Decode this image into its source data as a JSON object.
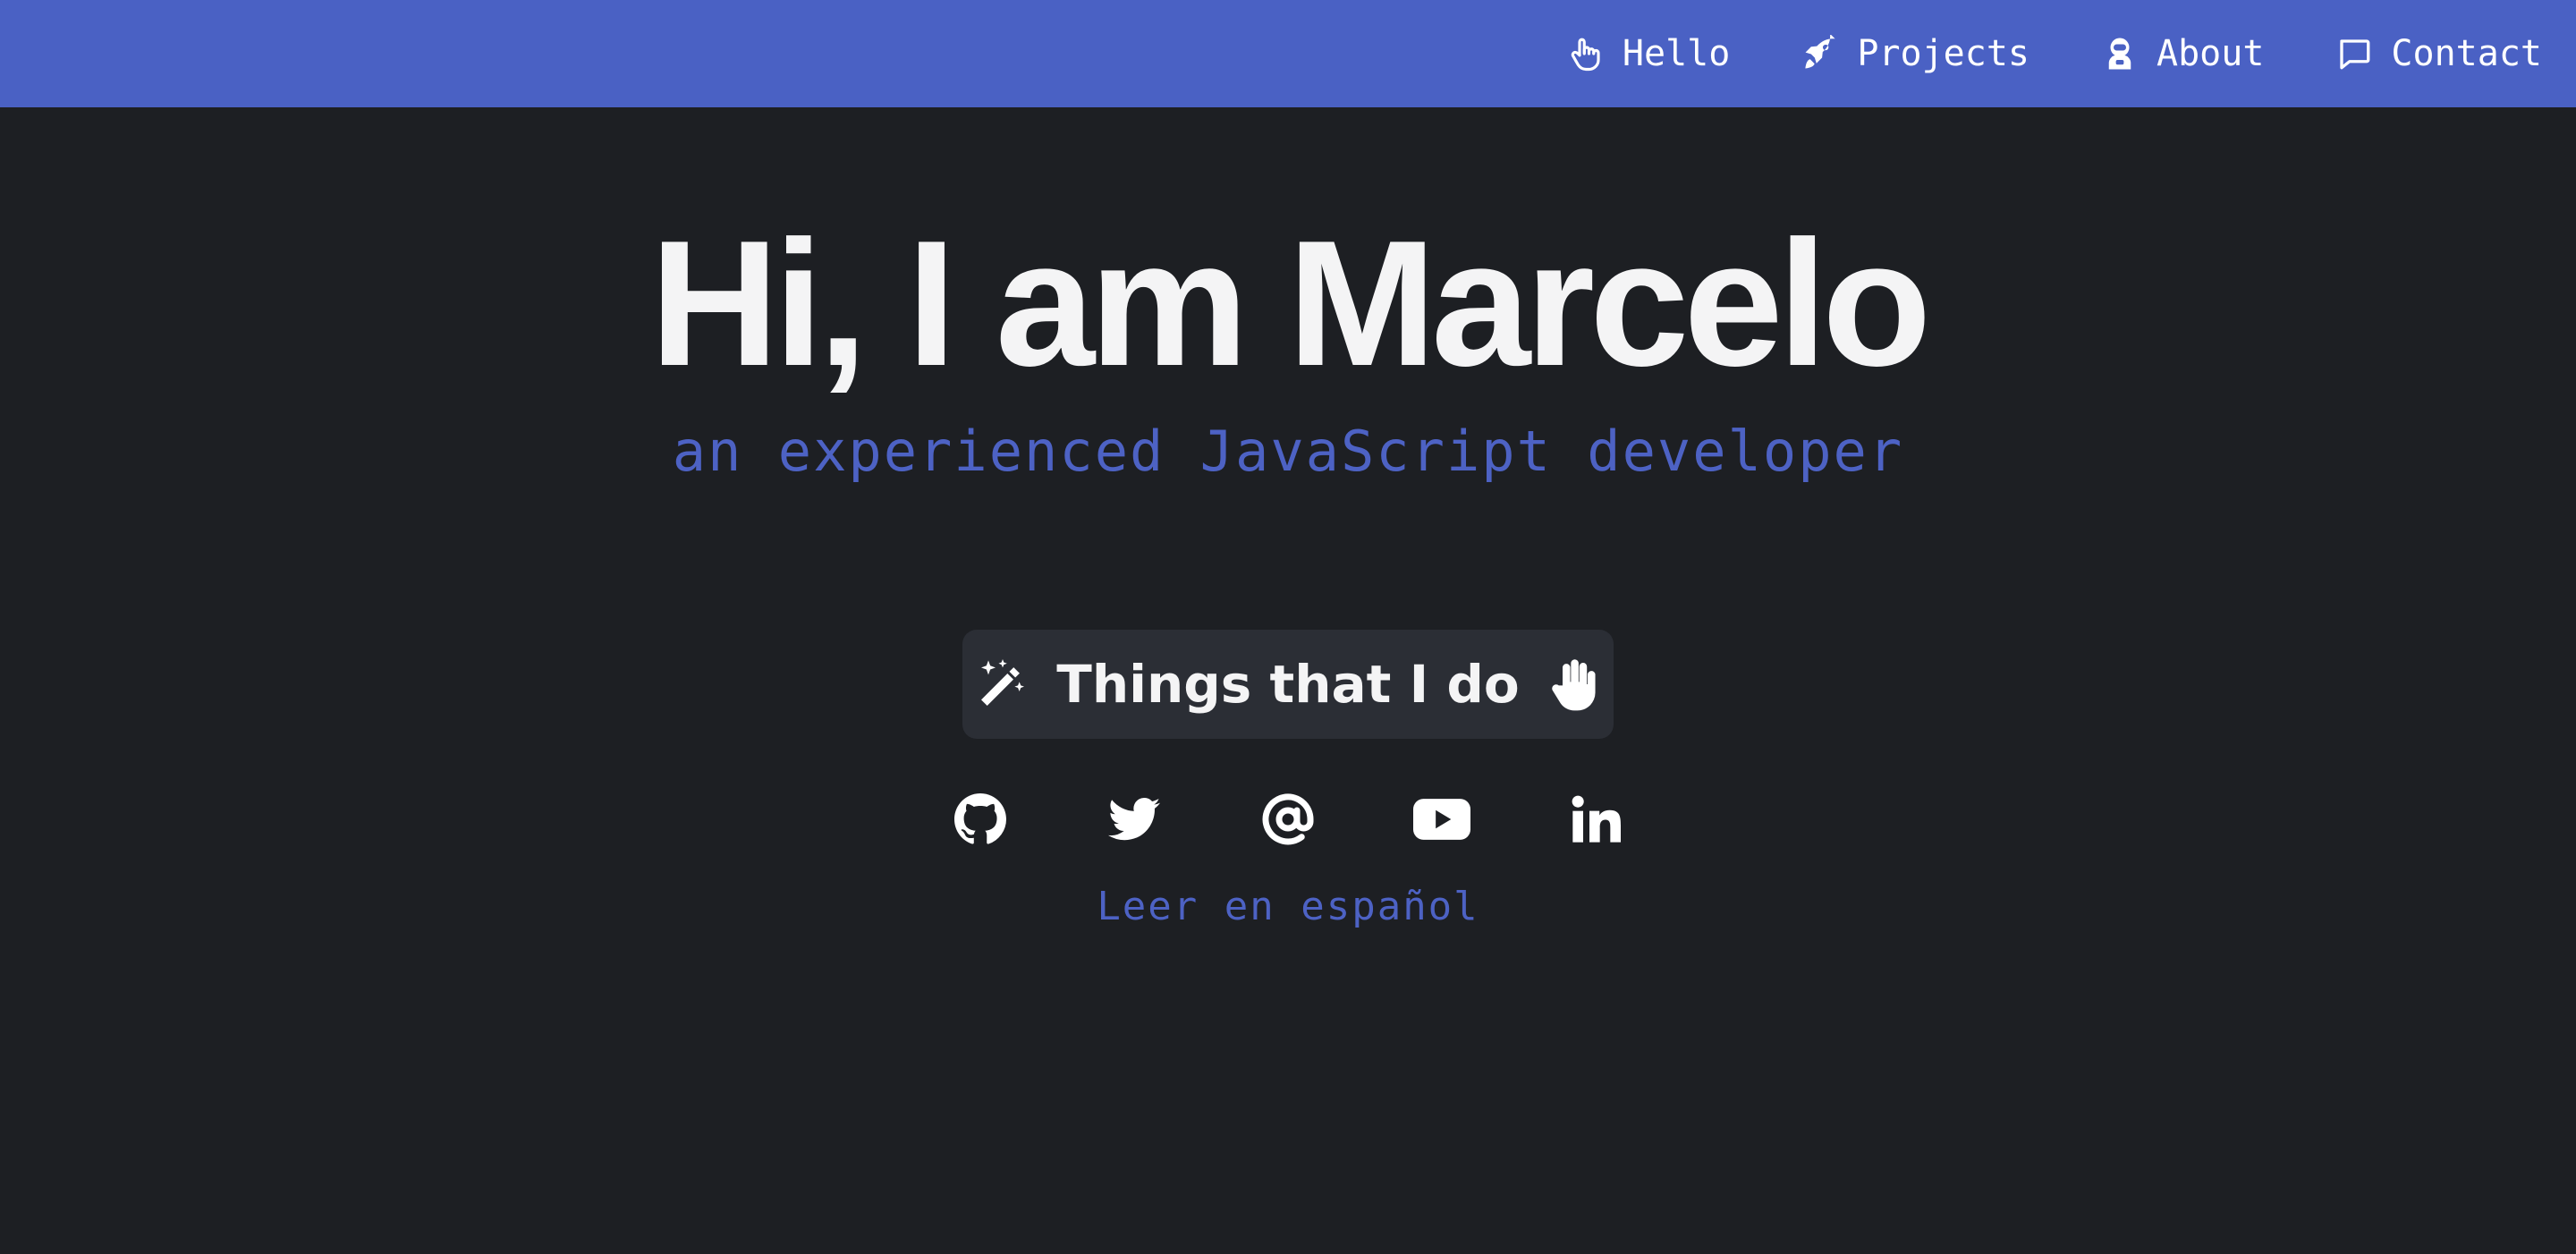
{
  "nav": {
    "items": [
      {
        "label": "Hello",
        "icon": "hand-icon"
      },
      {
        "label": "Projects",
        "icon": "rocket-icon"
      },
      {
        "label": "About",
        "icon": "astronaut-icon"
      },
      {
        "label": "Contact",
        "icon": "message-icon"
      }
    ]
  },
  "hero": {
    "headline": "Hi, I am Marcelo",
    "subline": "an experienced JavaScript developer",
    "cta_label": "Things that I do"
  },
  "socials": [
    {
      "icon": "github-icon"
    },
    {
      "icon": "twitter-icon"
    },
    {
      "icon": "at-sign-icon"
    },
    {
      "icon": "youtube-icon"
    },
    {
      "icon": "linkedin-icon"
    }
  ],
  "language_link": "Leer en español",
  "colors": {
    "accent": "#4a61c4",
    "background": "#1d1f23",
    "button_bg": "#2b2e35",
    "text": "#f4f4f5"
  }
}
